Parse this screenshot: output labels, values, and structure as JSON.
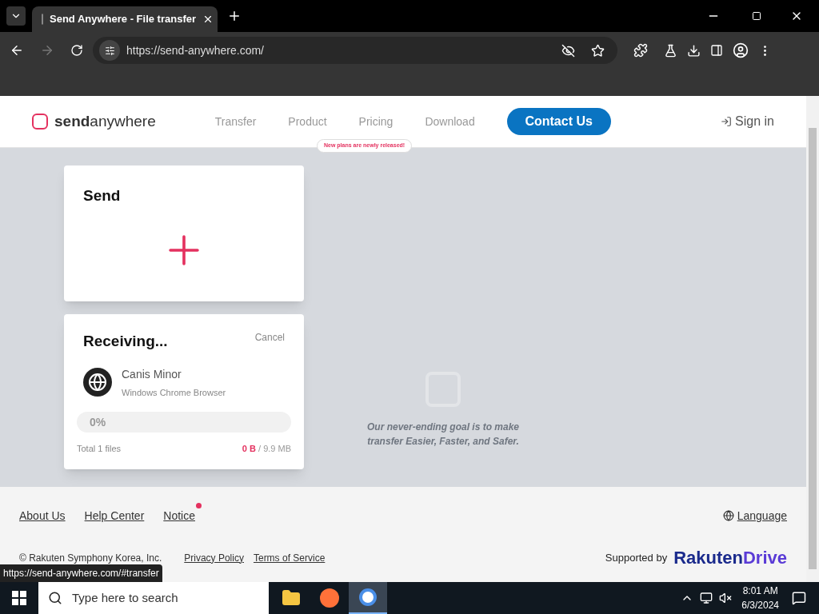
{
  "browser": {
    "tab_title": "Send Anywhere - File transfer",
    "url": "https://send-anywhere.com/",
    "status_url": "https://send-anywhere.com/#transfer"
  },
  "header": {
    "logo_bold": "send",
    "logo_light": "anywhere",
    "nav": [
      {
        "label": "Transfer"
      },
      {
        "label": "Product"
      },
      {
        "label": "Pricing"
      },
      {
        "label": "Download"
      }
    ],
    "pricing_badge": "New plans are newly released!",
    "contact": "Contact Us",
    "sign_in": "Sign in"
  },
  "send_card": {
    "title": "Send"
  },
  "receive_card": {
    "title": "Receiving...",
    "cancel": "Cancel",
    "device_name": "Canis Minor",
    "device_type": "Windows Chrome Browser",
    "progress_text": "0%",
    "level": 0,
    "total": "Total 1 files",
    "received": "0 B",
    "size": "/ 9.9 MB"
  },
  "tagline": [
    "Our never-ending goal is to make",
    "transfer Easier, Faster, and Safer."
  ],
  "footer": {
    "links": [
      {
        "label": "About Us",
        "dot": false
      },
      {
        "label": "Help Center",
        "dot": false
      },
      {
        "label": "Notice",
        "dot": true
      }
    ],
    "language": "Language",
    "copyright": "© Rakuten Symphony Korea, Inc.",
    "legal": [
      "Privacy Policy",
      "Terms of Service"
    ],
    "supported": "Supported by",
    "brand_a": "Rakuten",
    "brand_b": "Drive"
  },
  "taskbar": {
    "search_placeholder": "Type here to search",
    "time": "8:01 AM",
    "date": "6/3/2024"
  }
}
